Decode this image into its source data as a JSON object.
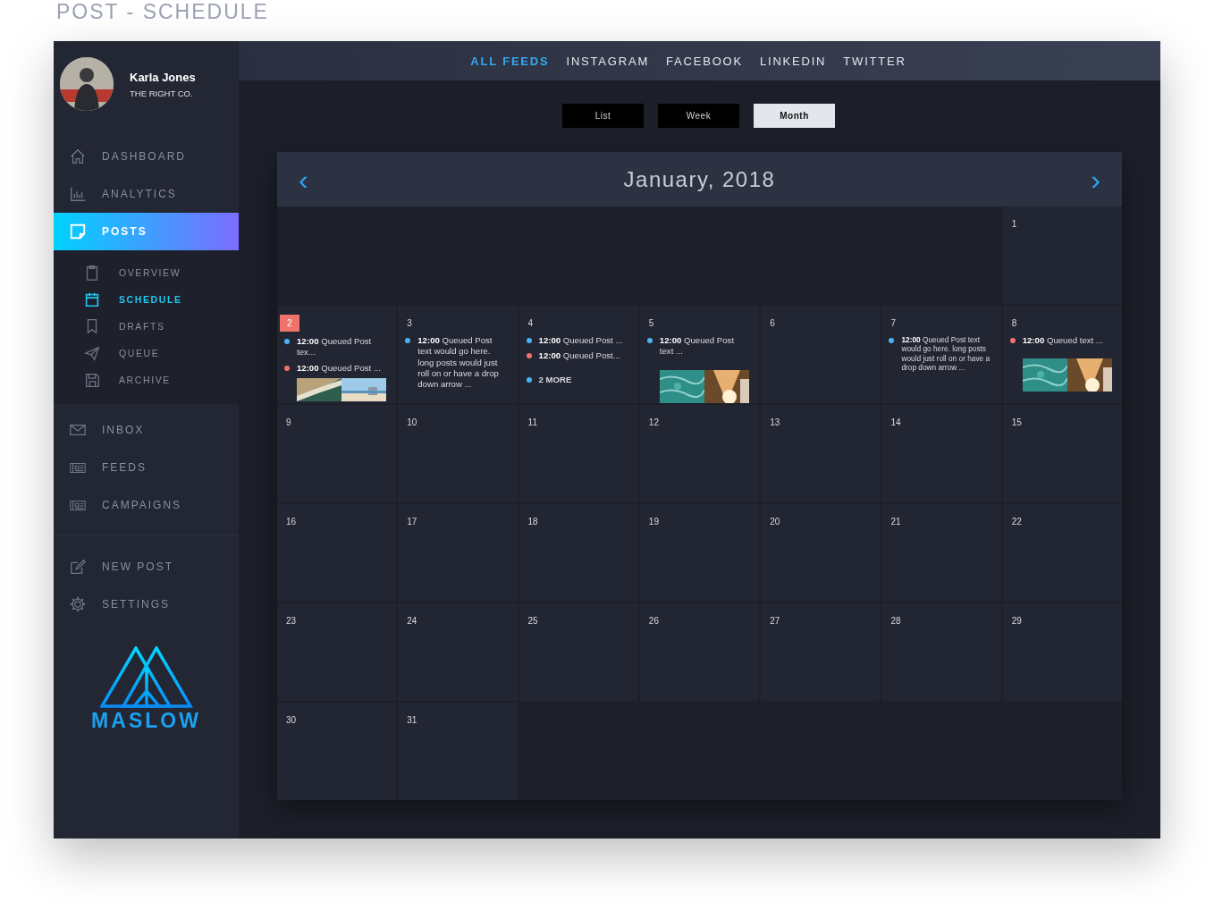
{
  "page_title": "POST - SCHEDULE",
  "profile": {
    "name": "Karla Jones",
    "company": "THE RIGHT CO."
  },
  "sidebar": {
    "groups": [
      {
        "items": [
          {
            "label": "DASHBOARD",
            "kind": "main",
            "selected": false
          },
          {
            "label": "ANALYTICS",
            "kind": "main",
            "selected": false
          },
          {
            "label": "POSTS",
            "kind": "main",
            "selected": true
          },
          {
            "label": "OVERVIEW",
            "kind": "sub",
            "selected": false
          },
          {
            "label": "SCHEDULE",
            "kind": "sub",
            "selected": true
          },
          {
            "label": "DRAFTS",
            "kind": "sub",
            "selected": false
          },
          {
            "label": "QUEUE",
            "kind": "sub",
            "selected": false
          },
          {
            "label": "ARCHIVE",
            "kind": "sub",
            "selected": false
          }
        ]
      },
      {
        "items": [
          {
            "label": "INBOX",
            "kind": "main",
            "selected": false
          },
          {
            "label": "FEEDS",
            "kind": "main",
            "selected": false
          },
          {
            "label": "CAMPAIGNS",
            "kind": "main",
            "selected": false
          }
        ]
      },
      {
        "items": [
          {
            "label": "NEW POST",
            "kind": "main",
            "selected": false
          },
          {
            "label": "SETTINGS",
            "kind": "main",
            "selected": false
          }
        ]
      }
    ],
    "logo": "MASLOW"
  },
  "feed_tabs": [
    {
      "label": "ALL FEEDS",
      "selected": true
    },
    {
      "label": "INSTAGRAM",
      "selected": false
    },
    {
      "label": "FACEBOOK",
      "selected": false
    },
    {
      "label": "LINKEDIN",
      "selected": false
    },
    {
      "label": "TWITTER",
      "selected": false
    }
  ],
  "view_buttons": [
    {
      "label": "List",
      "selected": false
    },
    {
      "label": "Week",
      "selected": false
    },
    {
      "label": "Month",
      "selected": true
    }
  ],
  "calendar": {
    "prev": "‹",
    "title": "January, 2018",
    "next": "›",
    "weeks": [
      [
        {
          "day": "1",
          "today": false
        }
      ],
      [
        {
          "day": "2",
          "today": true,
          "events": [
            {
              "kind": "post",
              "time": "12:00",
              "text": "Queued Post tex...",
              "color": "#4ab3f4"
            },
            {
              "kind": "post",
              "time": "12:00",
              "text": "Queued Post ...",
              "color": "#f0736b"
            }
          ],
          "media": [
            {
              "kind": "picture"
            },
            {
              "kind": "picture"
            }
          ]
        },
        {
          "day": "3",
          "today": false,
          "events": [
            {
              "kind": "post",
              "time": "12:00",
              "text": "Queued Post text would go here. long posts would just roll on or have a drop down arrow ...",
              "color": "#4ab3f4"
            }
          ]
        },
        {
          "day": "4",
          "today": false,
          "events": [
            {
              "kind": "post",
              "time": "12:00",
              "text": "Queued Post ...",
              "color": "#4ab3f4"
            },
            {
              "kind": "post",
              "time": "12:00",
              "text": "Queued Post...",
              "color": "#f0736b"
            },
            {
              "kind": "more",
              "text": "2 MORE",
              "color": "#4ab3f4"
            }
          ]
        },
        {
          "day": "5",
          "today": false,
          "events": [
            {
              "kind": "post",
              "time": "12:00",
              "text": "Queued Post text ...",
              "color": "#4ab3f4"
            }
          ],
          "media": [
            {
              "kind": "picture"
            },
            {
              "kind": "picture"
            }
          ]
        },
        {
          "day": "6",
          "today": false
        },
        {
          "day": "7",
          "today": false,
          "events": [
            {
              "kind": "post",
              "time": "12:00",
              "text": "Queued Post text would go here. long posts would just roll on or have a drop down arrow ...",
              "color": "#4ab3f4"
            }
          ]
        },
        {
          "day": "8",
          "today": false,
          "events": [
            {
              "kind": "post",
              "time": "12:00",
              "text": "Queued  text ...",
              "color": "#f0736b"
            }
          ],
          "media": [
            {
              "kind": "picture"
            },
            {
              "kind": "picture"
            }
          ]
        }
      ],
      [
        {
          "day": "9",
          "today": false
        },
        {
          "day": "10",
          "today": false
        },
        {
          "day": "11",
          "today": false
        },
        {
          "day": "12",
          "today": false
        },
        {
          "day": "13",
          "today": false
        },
        {
          "day": "14",
          "today": false
        },
        {
          "day": "15",
          "today": false
        }
      ],
      [
        {
          "day": "16",
          "today": false
        },
        {
          "day": "17",
          "today": false
        },
        {
          "day": "18",
          "today": false
        },
        {
          "day": "19",
          "today": false
        },
        {
          "day": "20",
          "today": false
        },
        {
          "day": "21",
          "today": false
        },
        {
          "day": "22",
          "today": false
        }
      ],
      [
        {
          "day": "23",
          "today": false
        },
        {
          "day": "24",
          "today": false
        },
        {
          "day": "25",
          "today": false
        },
        {
          "day": "26",
          "today": false
        },
        {
          "day": "27",
          "today": false
        },
        {
          "day": "28",
          "today": false
        },
        {
          "day": "29",
          "today": false
        }
      ],
      [
        {
          "day": "30",
          "today": false
        },
        {
          "day": "31",
          "today": false
        }
      ]
    ]
  }
}
